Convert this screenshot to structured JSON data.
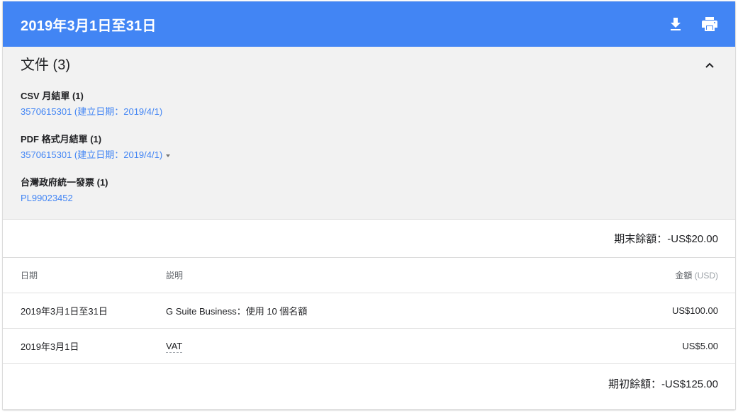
{
  "header": {
    "title": "2019年3月1日至31日",
    "download_icon": "download-icon",
    "print_icon": "print-icon"
  },
  "documents": {
    "title": "文件 (3)",
    "groups": [
      {
        "label": "CSV 月結單 (1)",
        "link": "3570615301 (建立日期：2019/4/1)",
        "has_dropdown": false
      },
      {
        "label": "PDF 格式月結單 (1)",
        "link": "3570615301 (建立日期：2019/4/1)",
        "has_dropdown": true
      },
      {
        "label": "台灣政府統一發票 (1)",
        "link": "PL99023452",
        "has_dropdown": false
      }
    ]
  },
  "ending_balance": "期末餘額：-US$20.00",
  "table": {
    "headers": {
      "date": "日期",
      "description": "説明",
      "amount": "金額",
      "amount_unit": "(USD)"
    },
    "rows": [
      {
        "date": "2019年3月1日至31日",
        "description": "G Suite Business：使用 10 個名額",
        "amount": "US$100.00"
      },
      {
        "date": "2019年3月1日",
        "description": "VAT",
        "amount": "US$5.00"
      }
    ]
  },
  "starting_balance": "期初餘額：-US$125.00",
  "colors": {
    "header_bg": "#4285f4",
    "link": "#4285f4",
    "docs_bg": "#f2f2f2"
  }
}
